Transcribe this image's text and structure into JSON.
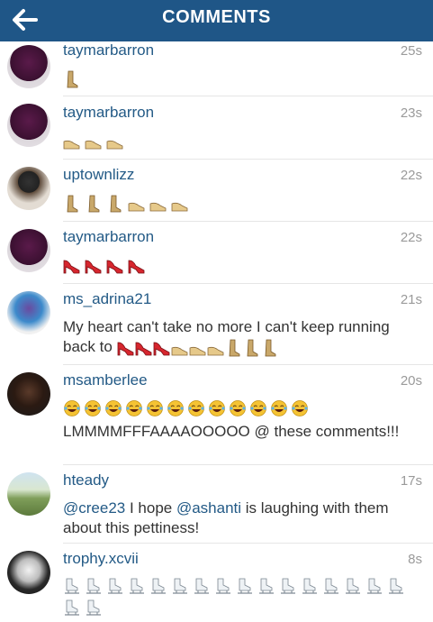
{
  "header": {
    "title": "COMMENTS",
    "back_icon": "back-arrow-icon"
  },
  "comments": [
    {
      "user": "taymarbarron",
      "time": "25s",
      "emojis": [
        "boot"
      ]
    },
    {
      "user": "taymarbarron",
      "time": "23s",
      "emojis": [
        "sandal",
        "sandal",
        "sandal"
      ]
    },
    {
      "user": "uptownlizz",
      "time": "22s",
      "emojis": [
        "boot",
        "boot",
        "boot",
        "sandal",
        "sandal",
        "sandal"
      ]
    },
    {
      "user": "taymarbarron",
      "time": "22s",
      "emojis": [
        "heel",
        "heel",
        "heel",
        "heel"
      ]
    },
    {
      "user": "ms_adrina21",
      "time": "21s",
      "text": "My heart can't take no more I can't keep running back to",
      "emojis": [
        "heel",
        "heel",
        "heel",
        "sandal",
        "sandal",
        "sandal",
        "boot",
        "boot",
        "boot"
      ]
    },
    {
      "user": "msamberlee",
      "time": "20s",
      "emojis": [
        "laugh",
        "laugh",
        "laugh",
        "laugh",
        "laugh",
        "laugh",
        "laugh",
        "laugh",
        "laugh",
        "laugh",
        "laugh",
        "laugh"
      ],
      "text": "LMMMMFFFAAAAOOOOO @ these comments!!!"
    },
    {
      "user": "hteady",
      "time": "17s",
      "mention1": "@cree23",
      "text_mid": " I hope ",
      "mention2": "@ashanti",
      "text": " is laughing with them about this pettiness!"
    },
    {
      "user": "trophy.xcvii",
      "time": "8s",
      "emojis": [
        "skate",
        "skate",
        "skate",
        "skate",
        "skate",
        "skate",
        "skate",
        "skate",
        "skate",
        "skate",
        "skate",
        "skate",
        "skate",
        "skate",
        "skate",
        "skate",
        "skate",
        "skate"
      ]
    }
  ]
}
